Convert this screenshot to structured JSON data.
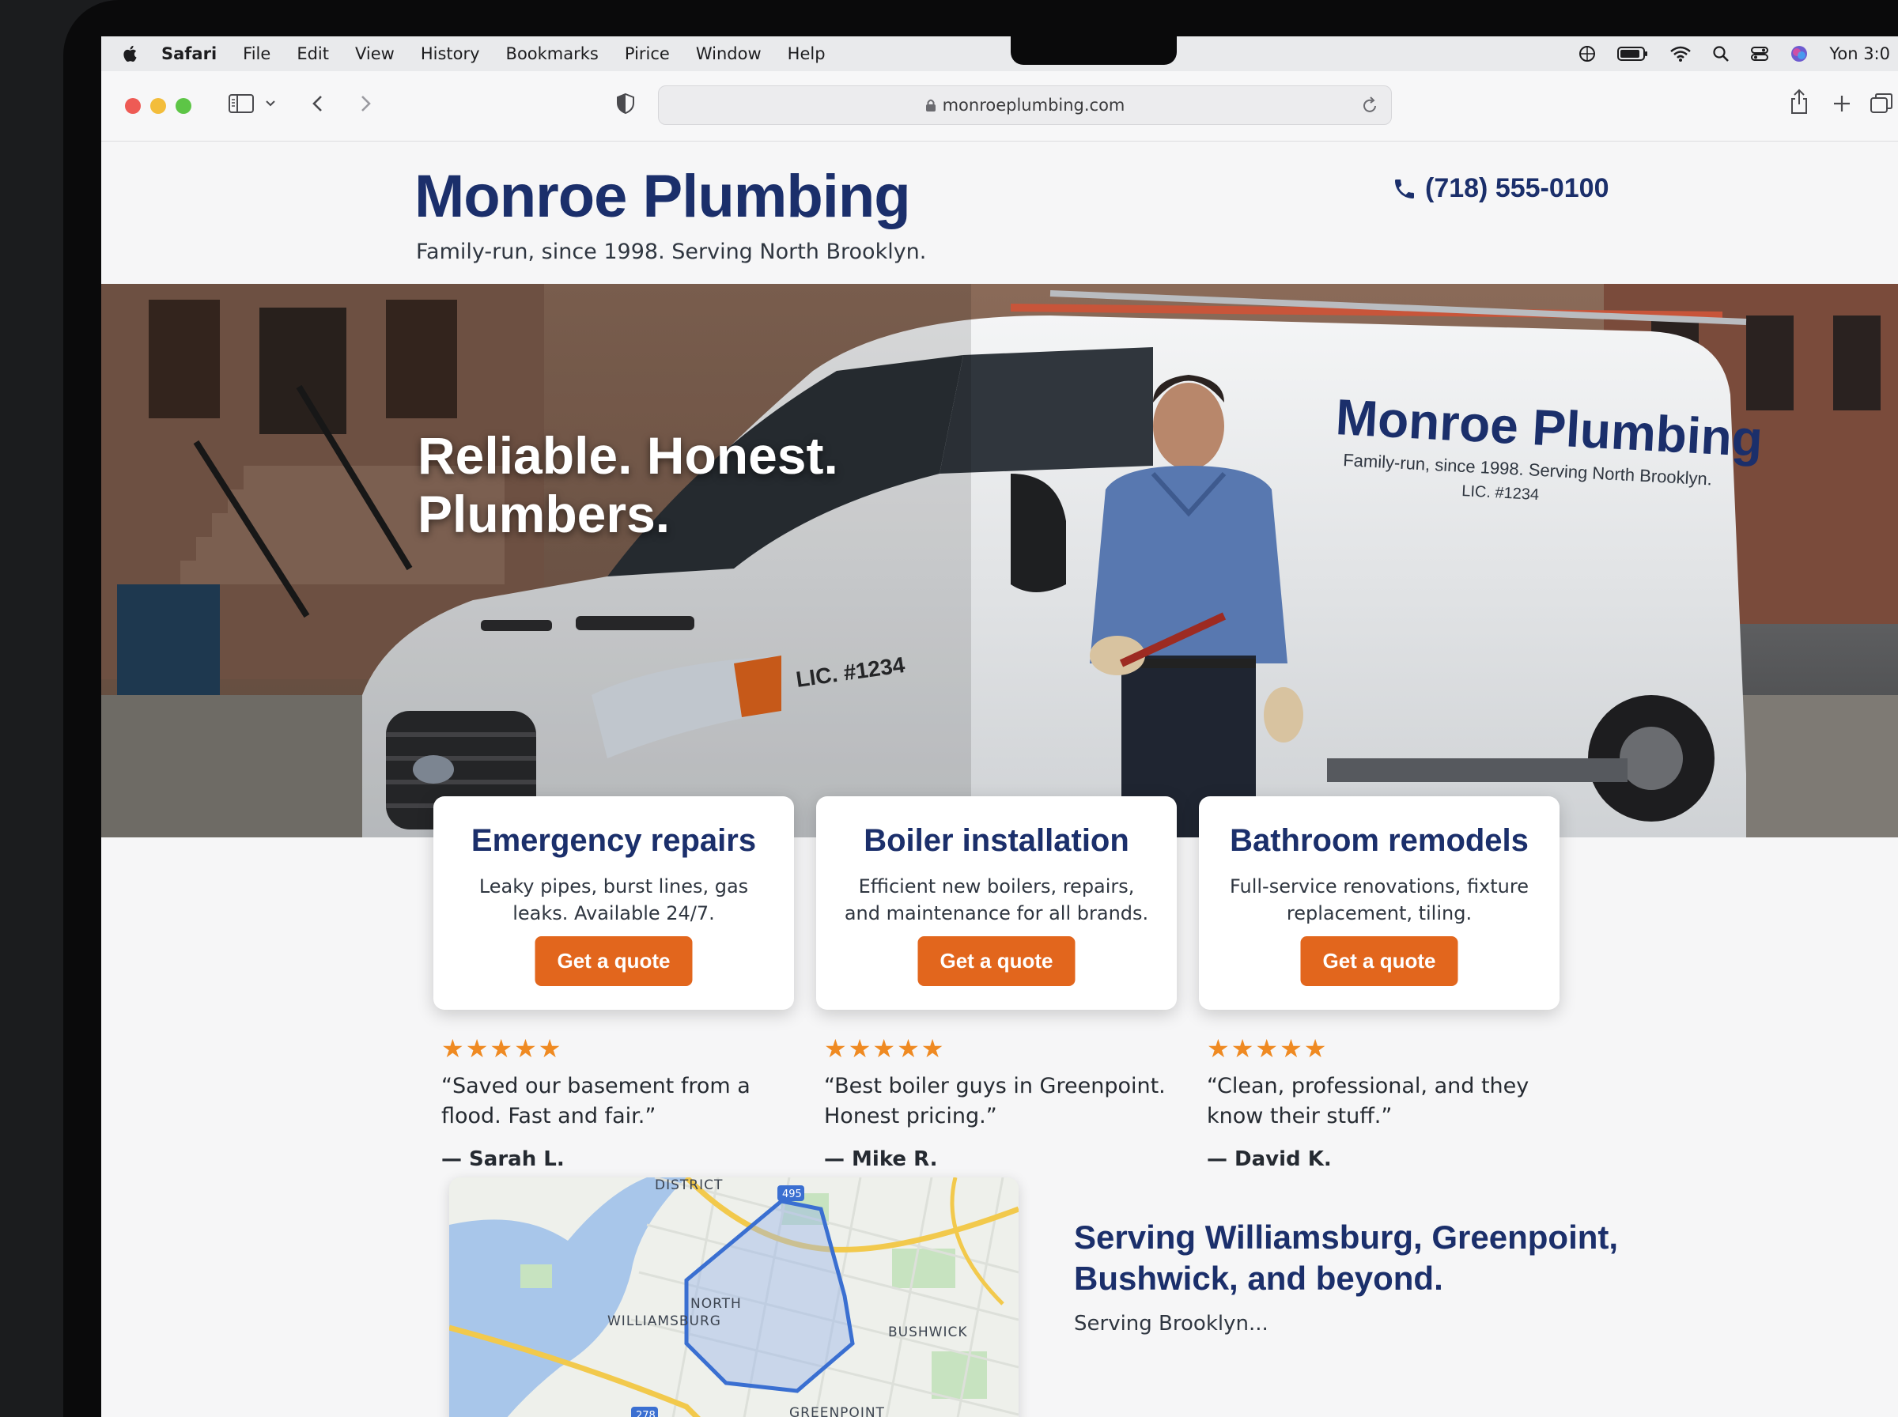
{
  "menubar": {
    "app_name": "Safari",
    "items": [
      "File",
      "Edit",
      "View",
      "History",
      "Bookmarks",
      "Pirice",
      "Window",
      "Help"
    ],
    "clock": "Yon 3:0"
  },
  "browser": {
    "url": "monroeplumbing.com"
  },
  "site": {
    "title": "Monroe Plumbing",
    "tagline": "Family-run, since 1998. Serving North Brooklyn.",
    "phone": "(718) 555-0100"
  },
  "hero": {
    "headline_line1": "Reliable. Honest.",
    "headline_line2": "Plumbers.",
    "van_brand": "Monroe Plumbing",
    "van_tagline": "Family-run, since 1998. Serving North Brooklyn.",
    "van_license": "LIC. #1234",
    "van_license_front": "LIC. #1234"
  },
  "services": [
    {
      "title": "Emergency repairs",
      "description": "Leaky pipes, burst lines, gas leaks. Available 24/7.",
      "button": "Get a quote"
    },
    {
      "title": "Boiler installation",
      "description": "Efficient new boilers, repairs, and maintenance for all brands.",
      "button": "Get a quote"
    },
    {
      "title": "Bathroom remodels",
      "description": "Full-service renovations, fixture replacement, tiling.",
      "button": "Get a quote"
    }
  ],
  "reviews": [
    {
      "stars": "★★★★★",
      "rating": 5,
      "text": "“Saved our basement from a flood. Fast and fair.”",
      "author": "— Sarah L."
    },
    {
      "stars": "★★★★★",
      "rating": 5,
      "text": "“Best boiler guys in Greenpoint. Honest pricing.”",
      "author": "— Mike R."
    },
    {
      "stars": "★★★★★",
      "rating": 5,
      "text": "“Clean, professional, and they know their stuff.”",
      "author": "— David K."
    }
  ],
  "map": {
    "labels": {
      "north_williamsburg_1": "NORTH",
      "north_williamsburg_2": "WILLIAMSBURG",
      "bushwick": "BUSHWICK",
      "greenpoint": "GREENPOINT",
      "district": "DISTRICT",
      "route_278": "278",
      "route_495": "495"
    }
  },
  "service_area": {
    "heading": "Serving Williamsburg, Greenpoint, Bushwick, and beyond.",
    "subtext": "Serving Brooklyn..."
  },
  "colors": {
    "brand_navy": "#1b2f6b",
    "accent_orange": "#e2661d",
    "star": "#ef8a22"
  }
}
